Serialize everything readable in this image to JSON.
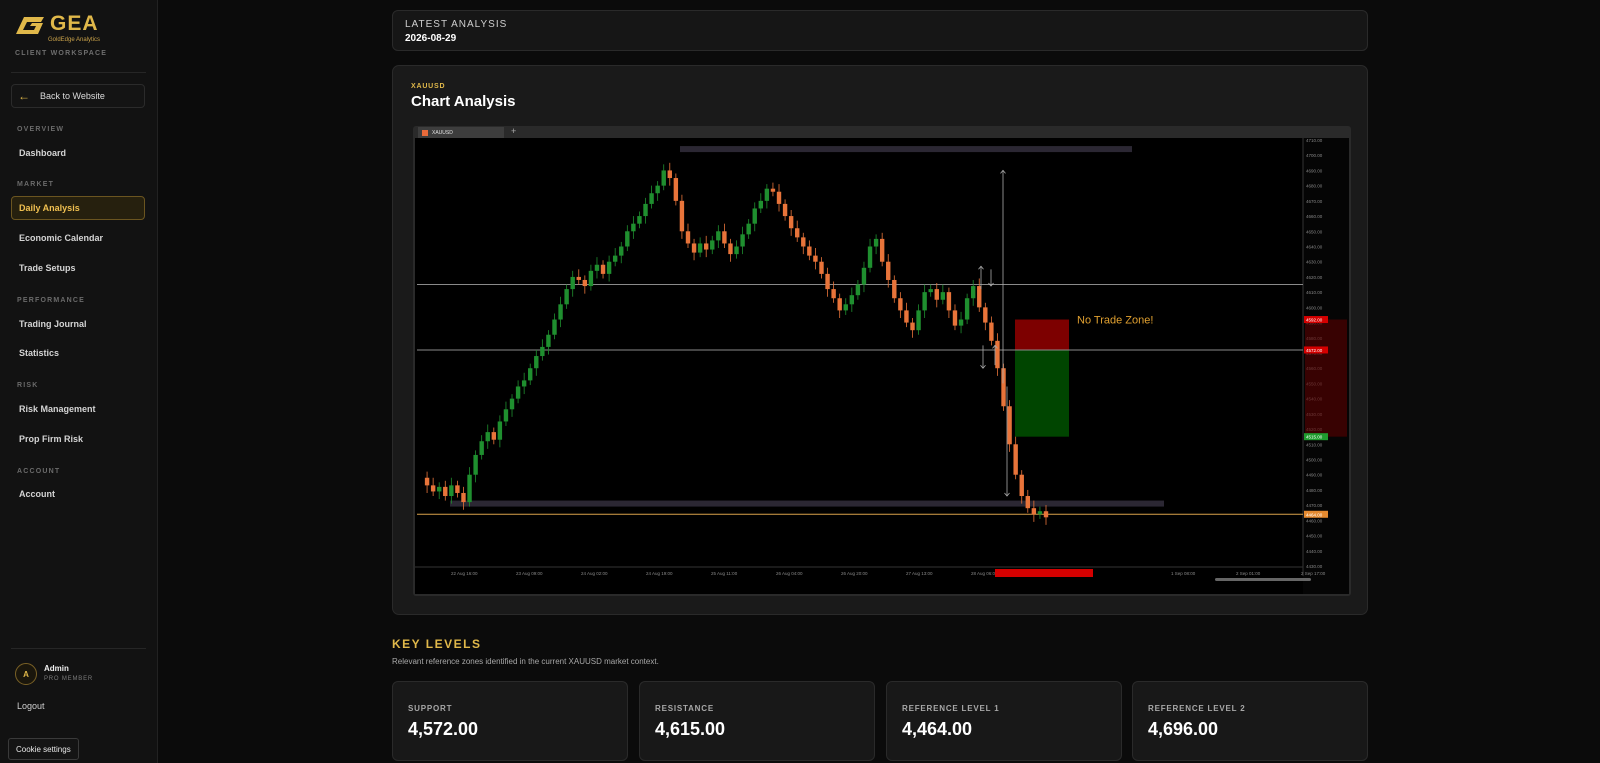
{
  "brand": {
    "name": "GEA",
    "tagline": "GoldEdge Analytics",
    "workspace": "CLIENT WORKSPACE"
  },
  "sidebar": {
    "back_label": "Back to Website",
    "sections": [
      {
        "title": "OVERVIEW",
        "items": [
          {
            "label": "Dashboard",
            "active": false
          }
        ]
      },
      {
        "title": "MARKET",
        "items": [
          {
            "label": "Daily Analysis",
            "active": true
          },
          {
            "label": "Economic Calendar",
            "active": false
          },
          {
            "label": "Trade Setups",
            "active": false
          }
        ]
      },
      {
        "title": "PERFORMANCE",
        "items": [
          {
            "label": "Trading Journal",
            "active": false
          },
          {
            "label": "Statistics",
            "active": false
          }
        ]
      },
      {
        "title": "RISK",
        "items": [
          {
            "label": "Risk Management",
            "active": false
          },
          {
            "label": "Prop Firm Risk",
            "active": false
          }
        ]
      },
      {
        "title": "ACCOUNT",
        "items": [
          {
            "label": "Account",
            "active": false
          }
        ]
      }
    ],
    "user": {
      "initial": "A",
      "name": "Admin",
      "role": "PRO MEMBER"
    },
    "logout_label": "Logout",
    "cookie_label": "Cookie settings"
  },
  "latest": {
    "title": "LATEST ANALYSIS",
    "date": "2026-08-29"
  },
  "chart_card": {
    "symbol": "XAUUSD",
    "title": "Chart Analysis",
    "tab_label": "XAUUSD",
    "zone_label": "No Trade Zone!"
  },
  "chart_data": {
    "type": "candlestick",
    "symbol": "XAUUSD",
    "x_tick_labels": [
      "22 Aug 16:00",
      "23 Aug 09:00",
      "24 Aug 02:00",
      "24 Aug 19:00",
      "25 Aug 11:00",
      "26 Aug 04:00",
      "26 Aug 20:00",
      "27 Aug 13:00",
      "28 Aug 06:00",
      "31 Aug 15:00",
      "1 Sep 08:00",
      "2 Sep 01:00",
      "2 Sep 17:00"
    ],
    "ylim": [
      4430,
      4710
    ],
    "y_ticks": [
      4430,
      4440,
      4450,
      4460,
      4470,
      4480,
      4490,
      4500,
      4510,
      4520,
      4530,
      4540,
      4550,
      4560,
      4570,
      4580,
      4590,
      4600,
      4610,
      4620,
      4630,
      4640,
      4650,
      4660,
      4670,
      4680,
      4690,
      4700,
      4710
    ],
    "close_path": [
      4488,
      4483,
      4479,
      4482,
      4476,
      4483,
      4478,
      4472,
      4490,
      4503,
      4512,
      4518,
      4513,
      4525,
      4533,
      4540,
      4548,
      4552,
      4560,
      4568,
      4574,
      4582,
      4592,
      4602,
      4612,
      4620,
      4618,
      4614,
      4624,
      4628,
      4622,
      4630,
      4634,
      4640,
      4650,
      4655,
      4660,
      4668,
      4675,
      4680,
      4690,
      4685,
      4670,
      4650,
      4642,
      4636,
      4642,
      4638,
      4644,
      4650,
      4642,
      4635,
      4640,
      4648,
      4655,
      4665,
      4670,
      4678,
      4676,
      4668,
      4660,
      4652,
      4646,
      4640,
      4634,
      4630,
      4622,
      4612,
      4606,
      4598,
      4602,
      4608,
      4615,
      4626,
      4640,
      4645,
      4630,
      4618,
      4606,
      4598,
      4590,
      4585,
      4598,
      4610,
      4612,
      4605,
      4610,
      4598,
      4588,
      4592,
      4606,
      4614,
      4600,
      4590,
      4578,
      4560,
      4535,
      4510,
      4490,
      4476,
      4468,
      4464,
      4466,
      4462
    ],
    "horizontal_levels": [
      4615,
      4572,
      4464
    ],
    "zones": [
      {
        "label": "No Trade Zone!",
        "from": 4572,
        "to": 4592,
        "color": "#8b0000"
      },
      {
        "label": "",
        "from": 4515,
        "to": 4572,
        "color": "#004d00"
      }
    ],
    "price_tags": [
      {
        "value": 4592,
        "color": "#d40000"
      },
      {
        "value": 4572,
        "color": "#d40000"
      },
      {
        "value": 4515,
        "color": "#1f9c2f"
      },
      {
        "value": 4464,
        "color": "#e58a30"
      }
    ],
    "up_color": "#1f8f2f",
    "down_color": "#e8743a"
  },
  "key_levels": {
    "title": "KEY LEVELS",
    "description": "Relevant reference zones identified in the current XAUUSD market context.",
    "cards": [
      {
        "label": "SUPPORT",
        "value": "4,572.00"
      },
      {
        "label": "RESISTANCE",
        "value": "4,615.00"
      },
      {
        "label": "REFERENCE LEVEL 1",
        "value": "4,464.00"
      },
      {
        "label": "REFERENCE LEVEL 2",
        "value": "4,696.00"
      }
    ]
  }
}
